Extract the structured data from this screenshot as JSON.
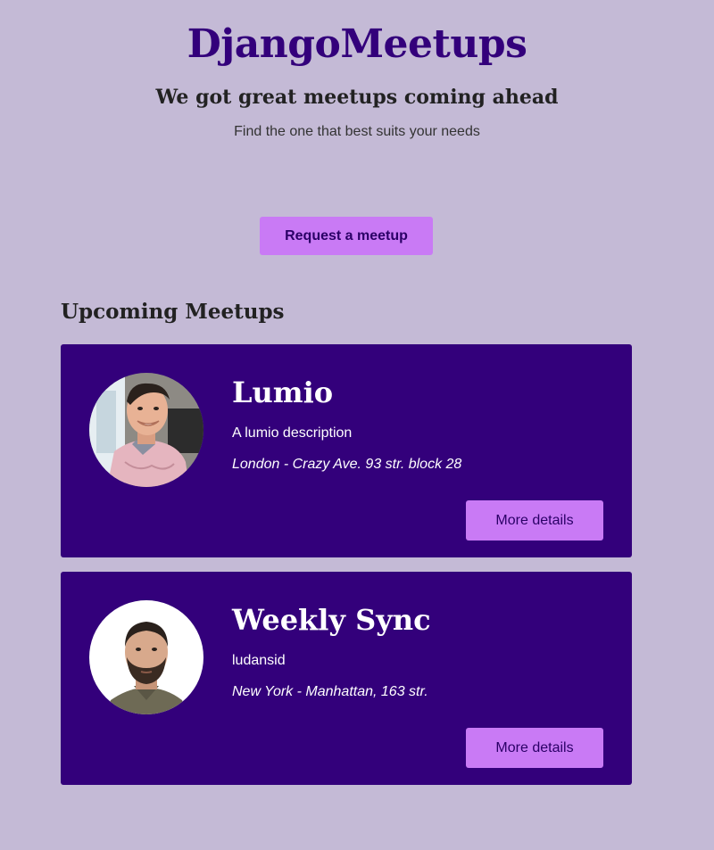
{
  "header": {
    "site_title": "DjangoMeetups",
    "tagline": "We got great meetups coming ahead",
    "subtagline": "Find the one that best suits your needs"
  },
  "actions": {
    "request_label": "Request a meetup"
  },
  "section": {
    "title": "Upcoming Meetups"
  },
  "meetups": [
    {
      "title": "Lumio",
      "description": "A lumio description",
      "location": "London - Crazy Ave. 93 str. block 28",
      "button_label": "More details",
      "avatar_icon": "person-photo-smiling"
    },
    {
      "title": "Weekly Sync",
      "description": "ludansid",
      "location": "New York - Manhattan, 163 str.",
      "button_label": "More details",
      "avatar_icon": "person-photo-bearded"
    }
  ],
  "colors": {
    "background": "#c4bad6",
    "brand": "#33007b",
    "card": "#33007b",
    "button": "#c97af5",
    "button_text": "#2a0066"
  }
}
